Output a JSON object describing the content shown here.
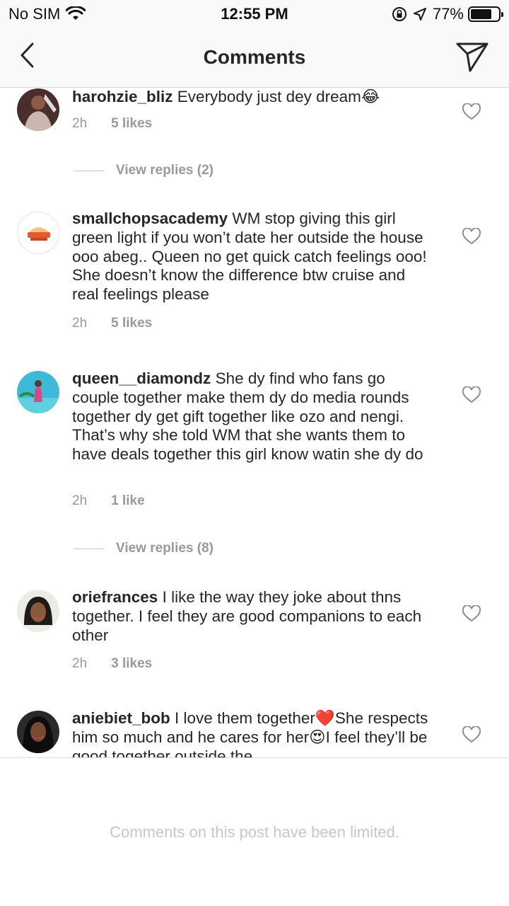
{
  "status_bar": {
    "carrier": "No SIM",
    "time": "12:55 PM",
    "battery": "77%",
    "battery_level": 0.77
  },
  "nav": {
    "title": "Comments",
    "back_icon": "chevron-left-icon",
    "send_icon": "direct-send-icon"
  },
  "comments": [
    {
      "username": "harohzie_bliz",
      "text": "Everybody just dey dream😂",
      "time": "2h",
      "likes": "5 likes"
    },
    {
      "username": "smallchopsacademy",
      "text": "WM stop giving this girl green light if you won’t date her outside the house ooo abeg.. Queen no get quick catch feelings ooo! She doesn’t know the difference btw cruise and real feelings please",
      "time": "2h",
      "likes": "5 likes"
    },
    {
      "username": "queen__diamondz",
      "text": "She dy find who fans go couple together make them dy do media rounds together dy get gift together like ozo and nengi. That’s why she told WM that she wants them to have deals together this girl know watin she dy do",
      "time": "2h",
      "likes": "1 like"
    },
    {
      "username": "oriefrances",
      "text": "I like the way they joke about thns together. I feel they are good companions to each other",
      "time": "2h",
      "likes": "3 likes"
    },
    {
      "username": "aniebiet_bob",
      "text": "I love them together❤️She respects him so much and he cares for her😍I feel they’ll be good together outside the",
      "time": "",
      "likes": ""
    }
  ],
  "replies": [
    {
      "label": "View replies (2)"
    },
    {
      "label": "View replies (8)"
    }
  ],
  "footer": {
    "text": "Comments on this post have been limited."
  },
  "colors": {
    "text": "#262626",
    "secondary": "#999999",
    "footer_text": "#c7c7c7",
    "bar_bg": "#f9f9f9"
  }
}
